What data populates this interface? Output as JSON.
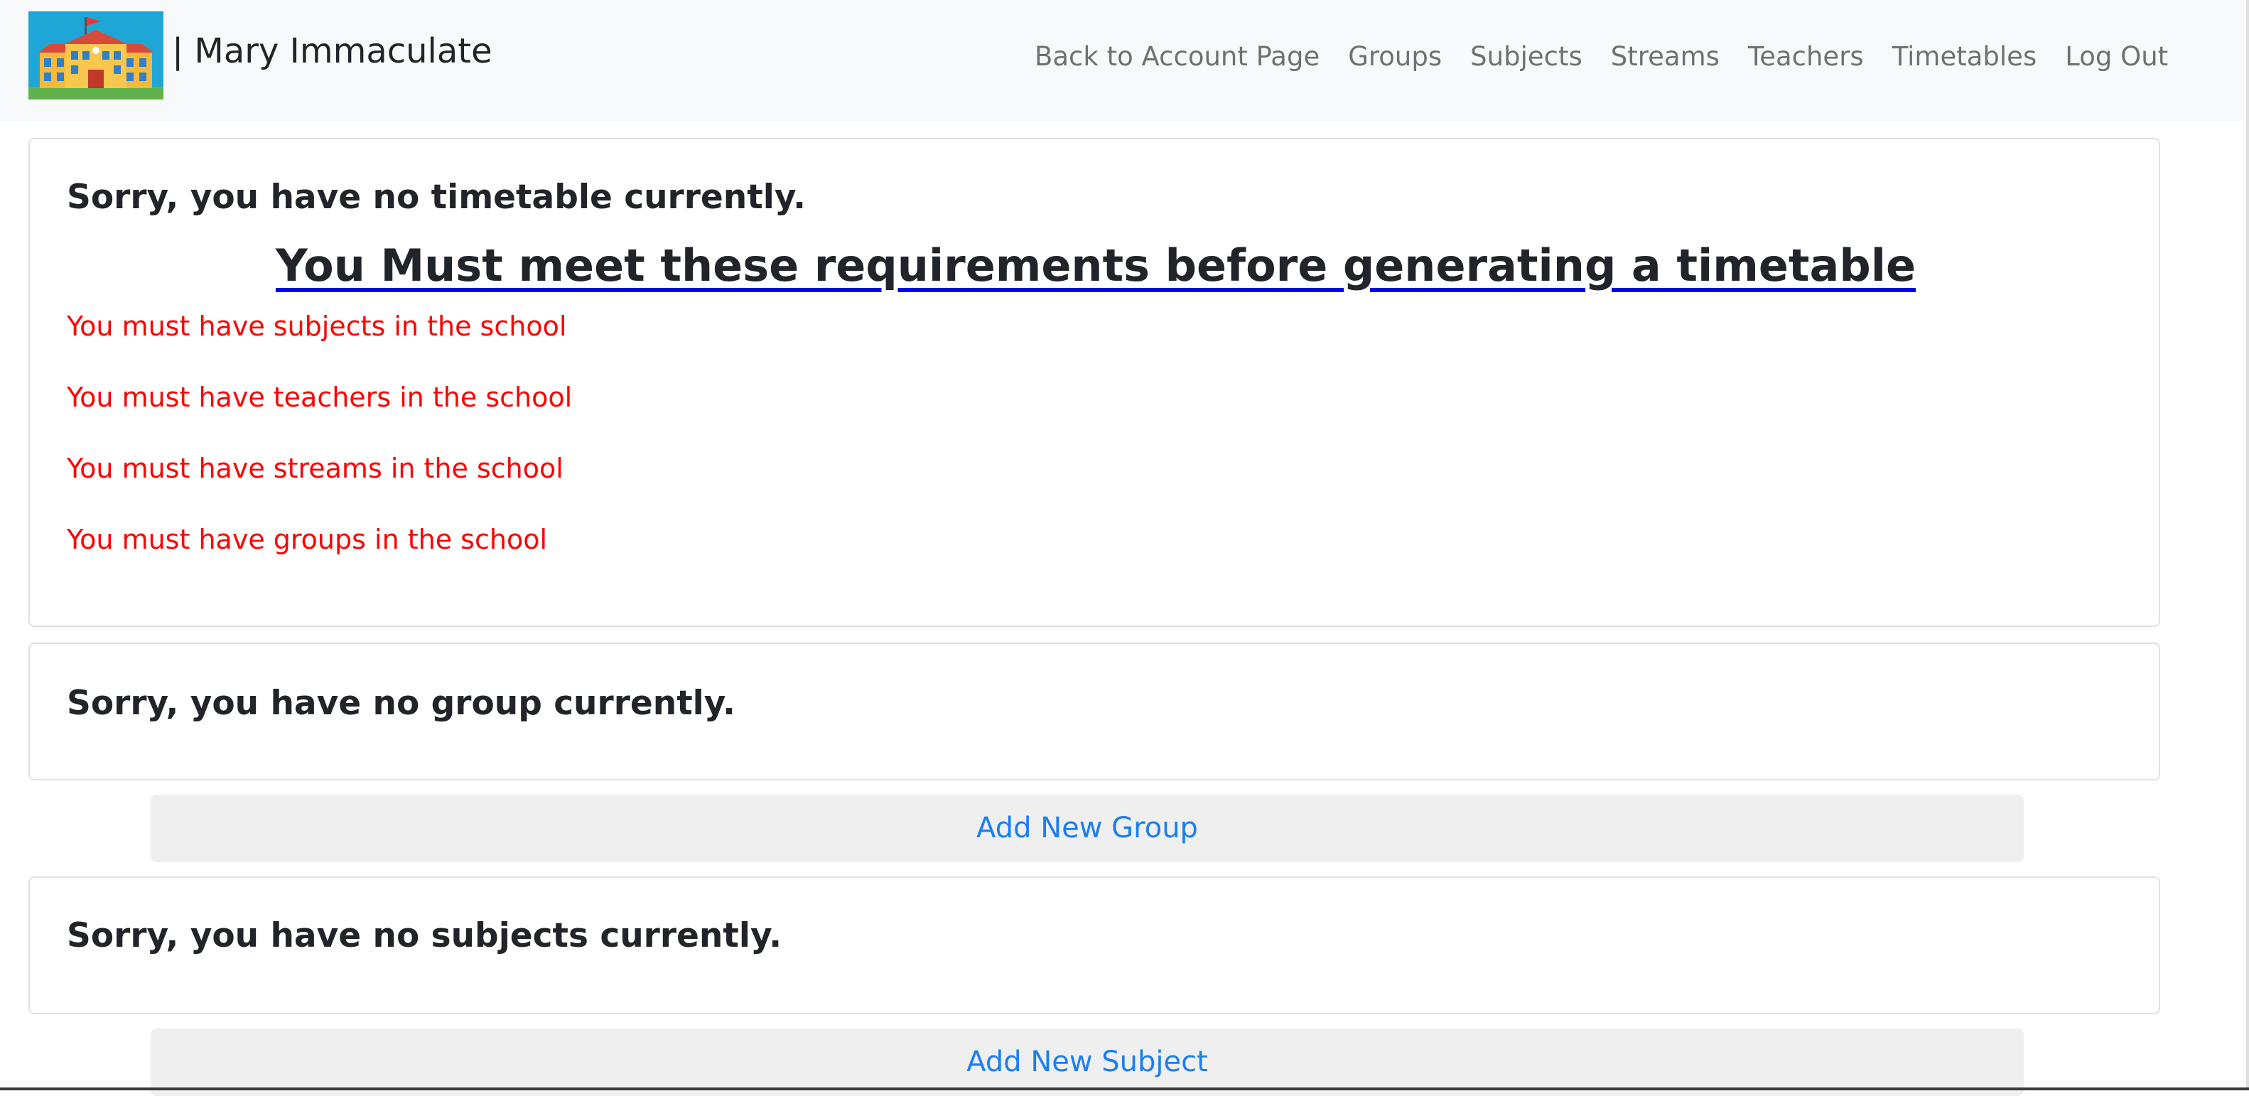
{
  "brand": {
    "name": "| Mary Immaculate",
    "logo_icon": "school-building-icon"
  },
  "nav": {
    "items": [
      {
        "label": "Back to Account Page"
      },
      {
        "label": "Groups"
      },
      {
        "label": "Subjects"
      },
      {
        "label": "Streams"
      },
      {
        "label": "Teachers"
      },
      {
        "label": "Timetables"
      },
      {
        "label": "Log Out"
      }
    ]
  },
  "timetable_card": {
    "title": "Sorry, you have no timetable currently.",
    "heading": "You Must meet these requirements before generating a timetable",
    "requirements": [
      "You must have subjects in the school",
      "You must have teachers in the school",
      "You must have streams in the school",
      "You must have groups in the school"
    ]
  },
  "group_card": {
    "title": "Sorry, you have no group currently.",
    "button": "Add New Group"
  },
  "subject_card": {
    "title": "Sorry, you have no subjects currently.",
    "button": "Add New Subject"
  },
  "colors": {
    "navbar_bg": "#f8f9fa",
    "requirement_text": "#ff0000",
    "link_blue": "#1a7ef2",
    "heading_underline": "#0000ee",
    "button_bg": "#efefef"
  }
}
